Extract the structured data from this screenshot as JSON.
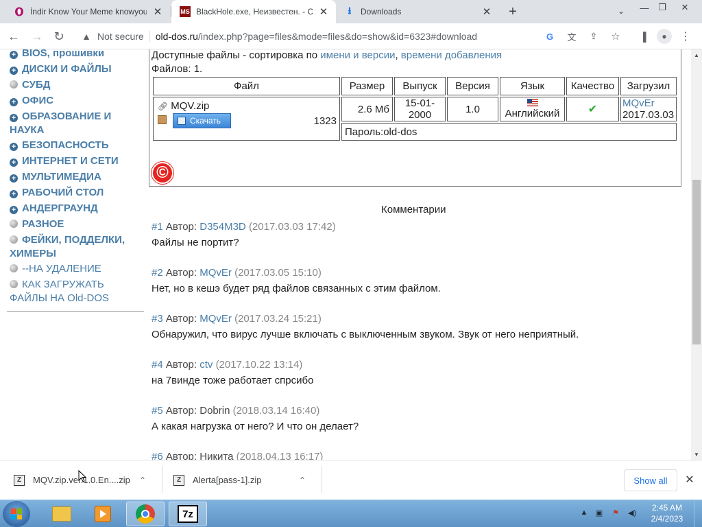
{
  "browser": {
    "tabs": [
      {
        "title": "İndir Know Your Meme knowyou",
        "icon": "opera-icon",
        "active": false
      },
      {
        "title": "BlackHole.exe, Неизвестен. - Ста",
        "icon": "ms-icon",
        "active": true
      },
      {
        "title": "Downloads",
        "icon": "download-icon",
        "active": false
      }
    ],
    "new_tab": "+",
    "tab_menu": "⌄",
    "window": {
      "minimize": "—",
      "restore": "❐",
      "close": "✕"
    },
    "address": {
      "security": "Not secure",
      "host": "old-dos.ru",
      "path": "/index.php?page=files&mode=files&do=show&id=6323#download"
    }
  },
  "sidebar": {
    "items": [
      {
        "label": "BIOS, прошивки",
        "icon": "plus"
      },
      {
        "label": "ДИСКИ И ФАЙЛЫ",
        "icon": "plus"
      },
      {
        "label": "СУБД",
        "icon": "dot"
      },
      {
        "label": "ОФИС",
        "icon": "plus"
      },
      {
        "label": "ОБРАЗОВАНИЕ И",
        "label2": "НАУКА",
        "icon": "plus"
      },
      {
        "label": "БЕЗОПАСНОСТЬ",
        "icon": "plus"
      },
      {
        "label": "ИНТЕРНЕТ И СЕТИ",
        "icon": "plus"
      },
      {
        "label": "МУЛЬТИМЕДИА",
        "icon": "plus"
      },
      {
        "label": "РАБОЧИЙ СТОЛ",
        "icon": "plus"
      },
      {
        "label": "АНДЕРГРАУНД",
        "icon": "plus"
      },
      {
        "label": "РАЗНОЕ",
        "icon": "dot"
      },
      {
        "label": "ФЕЙКИ, ПОДДЕЛКИ,",
        "label2": "ХИМЕРЫ",
        "icon": "dot"
      },
      {
        "label": "--НА УДАЛЕНИЕ",
        "icon": "dot"
      },
      {
        "label": "КАК ЗАГРУЖАТЬ",
        "label2": "ФАЙЛЫ НА Old-DOS",
        "icon": "dot"
      }
    ]
  },
  "files": {
    "heading_prefix": "Доступные файлы - сортировка по ",
    "sort_name": "имени и версии",
    "sort_sep": ", ",
    "sort_date": "времени добавления",
    "count_label": "Файлов: 1.",
    "columns": [
      "Файл",
      "Размер",
      "Выпуск",
      "Версия",
      "Язык",
      "Качество",
      "Загрузил"
    ],
    "row": {
      "name": "MQV.zip",
      "download_label": "Скачать",
      "downloads": "1323",
      "size": "2.6 Мб",
      "release": "15-01-2000",
      "version": "1.0",
      "language": "Английский",
      "quality": "✔",
      "uploader": "MQvEr",
      "upload_date": "2017.03.03"
    },
    "password": "Пароль:old-dos",
    "copyright_symbol": "©"
  },
  "comments": {
    "title": "Комментарии",
    "author_label": "Автор:",
    "items": [
      {
        "num": "#1",
        "author": "D354M3D",
        "author_link": true,
        "date": "(2017.03.03 17:42)",
        "text": "Файлы не портит?"
      },
      {
        "num": "#2",
        "author": "MQvEr",
        "author_link": true,
        "date": "(2017.03.05 15:10)",
        "text": "Нет, но в кешэ будет ряд файлов связанных с этим файлом."
      },
      {
        "num": "#3",
        "author": "MQvEr",
        "author_link": true,
        "date": "(2017.03.24 15:21)",
        "text": "Обнаружил, что вирус лучше включать с выключенным звуком. Звук от него неприятный."
      },
      {
        "num": "#4",
        "author": "ctv",
        "author_link": true,
        "date": "(2017.10.22 13:14)",
        "text": "на 7винде тоже работает спрсибо"
      },
      {
        "num": "#5",
        "author": "Dobrin",
        "author_link": false,
        "date": "(2018.03.14 16:40)",
        "text": "А какая нагрузка от него? И что он делает?"
      },
      {
        "num": "#6",
        "author": "Никита",
        "author_link": false,
        "date": "(2018.04.13 16:17)",
        "text": ""
      }
    ]
  },
  "downloads_bar": {
    "items": [
      {
        "name": "MQV.zip.ver.1.0.En....zip"
      },
      {
        "name": "Alerta[pass-1].zip"
      }
    ],
    "show_all": "Show all",
    "close": "✕"
  },
  "taskbar": {
    "time": "2:45 AM",
    "date": "2/4/2023"
  }
}
